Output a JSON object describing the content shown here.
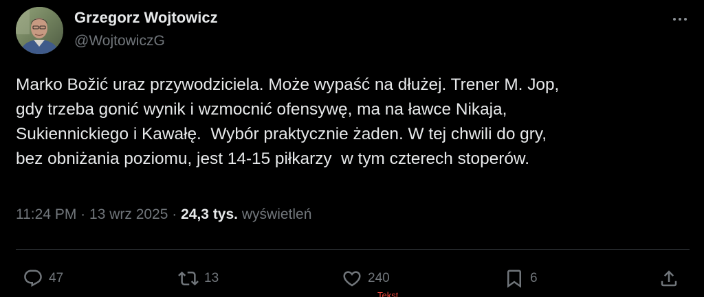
{
  "author": {
    "display_name": "Grzegorz Wojtowicz",
    "handle": "@WojtowiczG"
  },
  "more_icon": "more-horizontal-icon",
  "tweet": {
    "lines": [
      "Marko Božić uraz przywodziciela. Może wypaść na dłużej. Trener M. Jop,",
      "gdy trzeba gonić wynik i wzmocnić ofensywę, ma na ławce Nikaja,",
      "Sukiennickiego i Kawałę.  Wybór praktycznie żaden. W tej chwili do gry,",
      "bez obniżania poziomu, jest 14-15 piłkarzy  w tym czterech stoperów."
    ]
  },
  "meta": {
    "time": "11:24 PM",
    "date": "13 wrz 2025",
    "separator": "·",
    "views_count": "24,3 tys.",
    "views_label": "wyświetleń"
  },
  "actions": {
    "reply": {
      "icon": "reply-icon",
      "count": "47"
    },
    "retweet": {
      "icon": "retweet-icon",
      "count": "13"
    },
    "like": {
      "icon": "heart-icon",
      "count": "240"
    },
    "bookmark": {
      "icon": "bookmark-icon",
      "count": "6"
    },
    "share": {
      "icon": "share-icon"
    }
  },
  "peek_text": "Tekst",
  "colors": {
    "background": "#000000",
    "text_primary": "#e7e9ea",
    "text_secondary": "#71767b",
    "divider": "#2f3336",
    "peek_red": "#f0493e"
  }
}
